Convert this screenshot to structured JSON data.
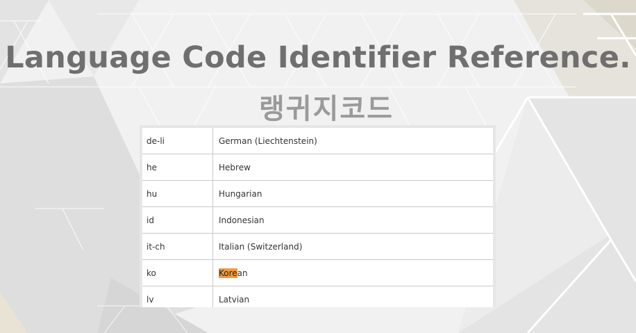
{
  "page": {
    "title": "Language Code Identifier Reference.",
    "subtitle": "랭귀지코드"
  },
  "table": {
    "rows": [
      {
        "code": "de-li",
        "name": "German (Liechtenstein)"
      },
      {
        "code": "he",
        "name": "Hebrew"
      },
      {
        "code": "hu",
        "name": "Hungarian"
      },
      {
        "code": "id",
        "name": "Indonesian"
      },
      {
        "code": "it-ch",
        "name": "Italian (Switzerland)"
      },
      {
        "code": "ko",
        "name": "Korean",
        "highlight": "Kore"
      },
      {
        "code": "lv",
        "name": "Latvian"
      }
    ]
  },
  "colors": {
    "title": "#6f6f6f",
    "subtitle": "#9a9a9a",
    "highlight": "#f39a3a"
  }
}
